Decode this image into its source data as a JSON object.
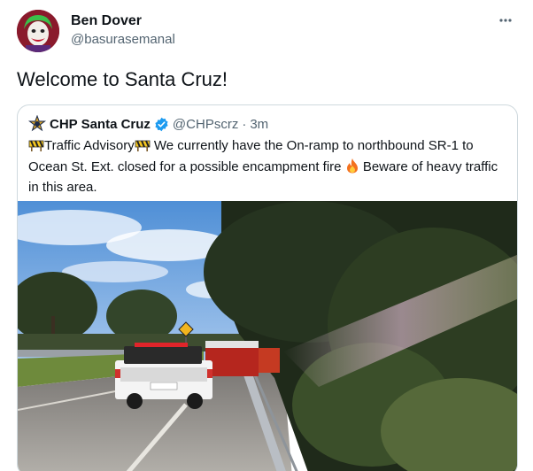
{
  "tweet": {
    "author_name": "Ben Dover",
    "author_handle": "@basurasemanal",
    "more_icon": "more-horizontal-icon",
    "text": "Welcome to Santa Cruz!"
  },
  "quoted_tweet": {
    "author_name": "CHP Santa Cruz",
    "verified_icon": "verified-badge-icon",
    "author_handle": "@CHPscrz",
    "separator": "·",
    "time": "3m",
    "text_part1": "Traffic Advisory",
    "text_part2": " We currently have the On-ramp to northbound SR-1 to Ocean St. Ext. closed for a possible encampment fire ",
    "text_part3": " Beware of heavy traffic in this area.",
    "media_alt": "Photo of a CHP truck and fire engine on a highway on-ramp among trees"
  },
  "colors": {
    "text_primary": "#0f1419",
    "text_secondary": "#536471",
    "border": "#cfd9de",
    "verified": "#1d9bf0"
  }
}
